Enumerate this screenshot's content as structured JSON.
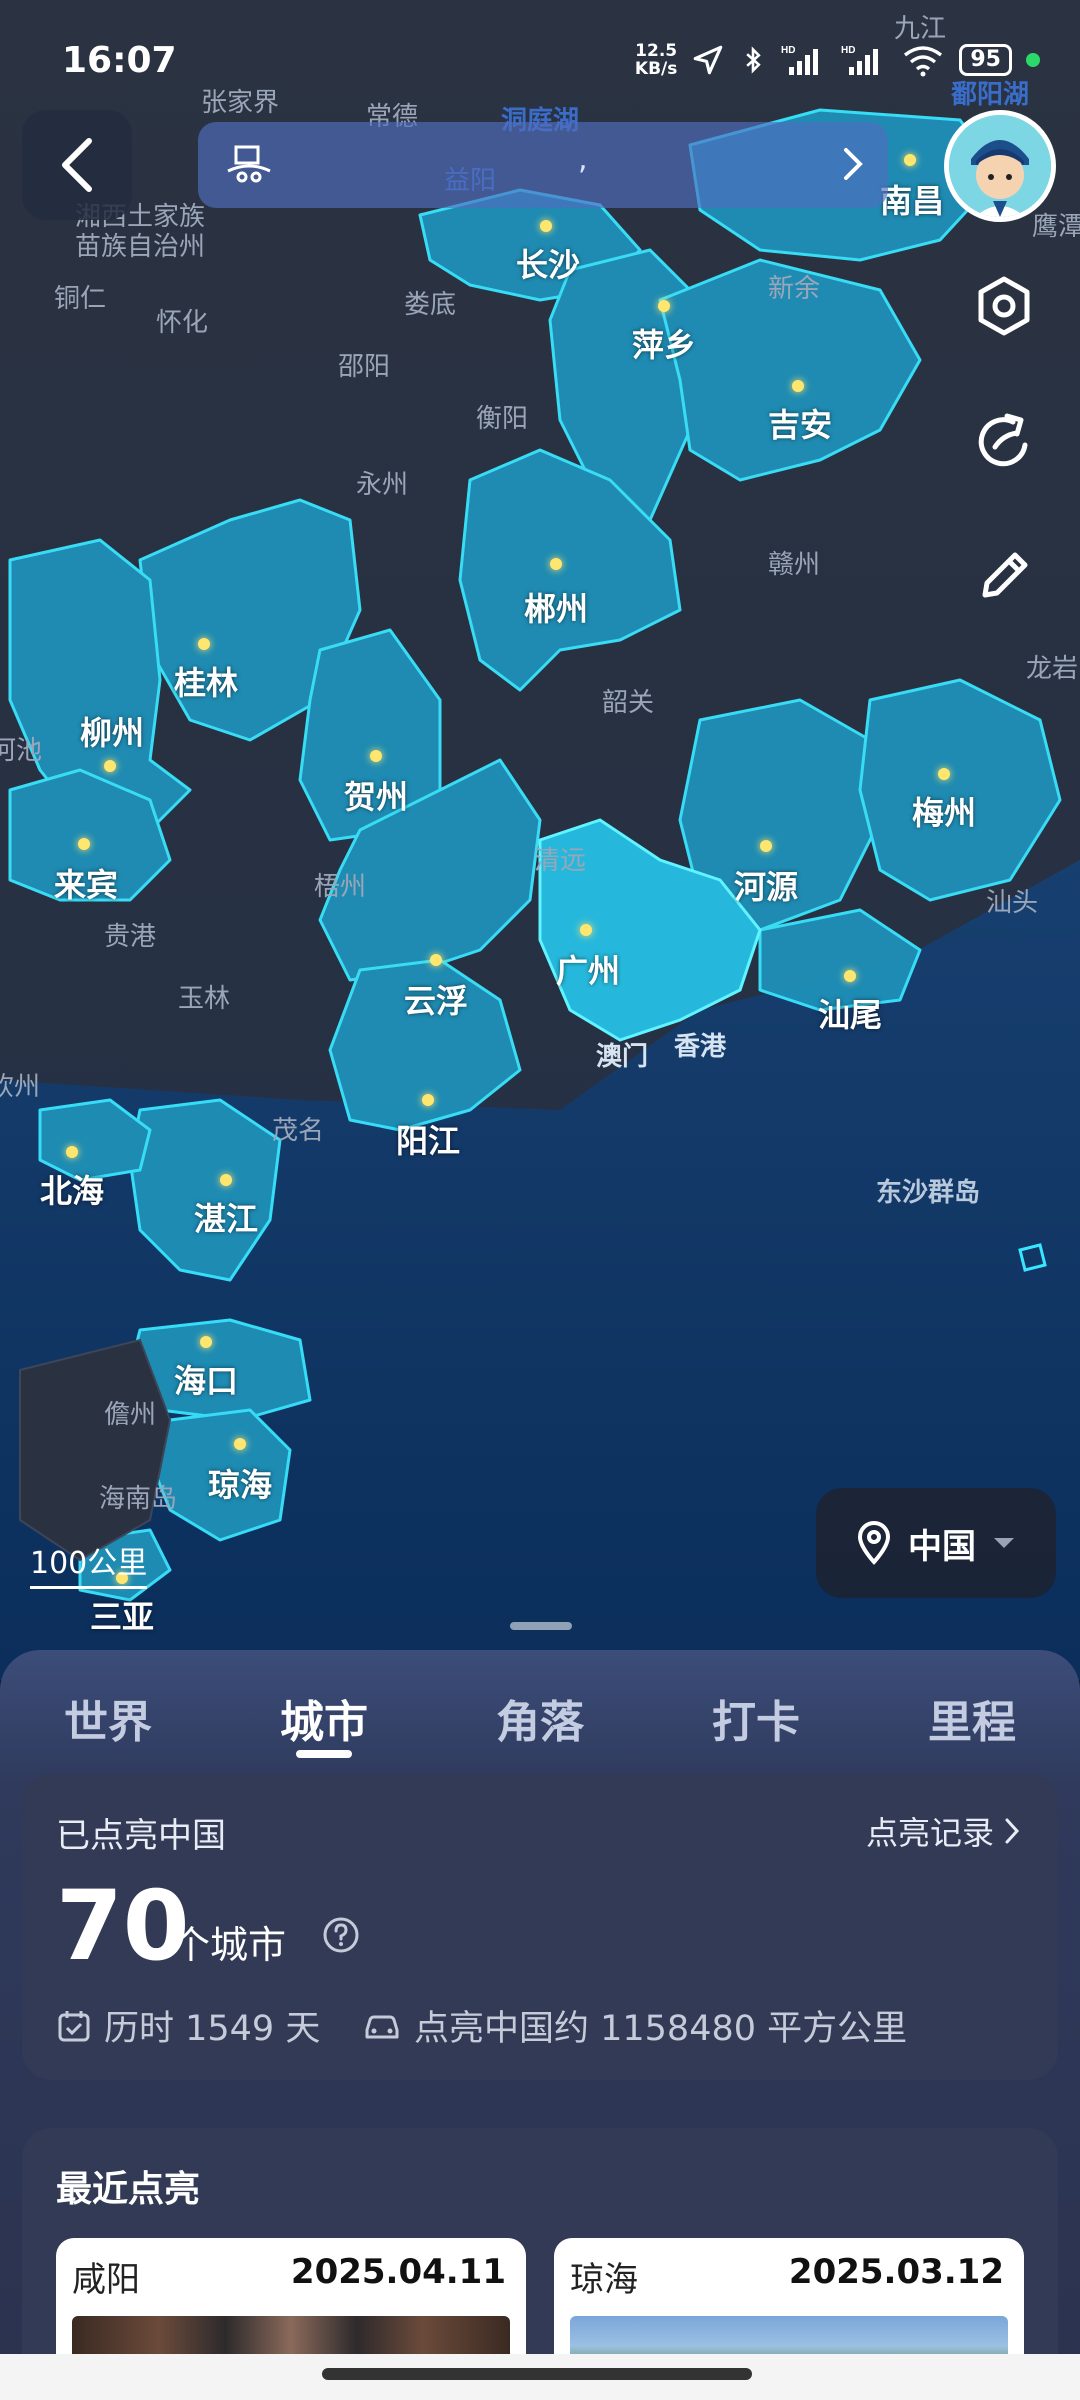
{
  "status_bar": {
    "time": "16:07",
    "net_speed_value": "12.5",
    "net_speed_unit": "KB/s",
    "battery": "95",
    "icons": [
      "location-arrow-icon",
      "bluetooth-icon",
      "signal-hd-icon",
      "signal-hd-icon",
      "wifi-icon",
      "battery-icon"
    ]
  },
  "map": {
    "cities_lit": [
      {
        "name": "南昌"
      },
      {
        "name": "长沙"
      },
      {
        "name": "萍乡"
      },
      {
        "name": "吉安"
      },
      {
        "name": "郴州"
      },
      {
        "name": "桂林"
      },
      {
        "name": "柳州"
      },
      {
        "name": "贺州"
      },
      {
        "name": "来宾"
      },
      {
        "name": "河源"
      },
      {
        "name": "梅州"
      },
      {
        "name": "广州"
      },
      {
        "name": "云浮"
      },
      {
        "name": "汕尾"
      },
      {
        "name": "阳江"
      },
      {
        "name": "北海"
      },
      {
        "name": "湛江"
      },
      {
        "name": "海口"
      },
      {
        "name": "琼海"
      },
      {
        "name": "三亚"
      }
    ],
    "places": [
      {
        "name": "张家界"
      },
      {
        "name": "常德"
      },
      {
        "name": "洞庭湖"
      },
      {
        "name": "九江"
      },
      {
        "name": "鄱阳湖"
      },
      {
        "name": "鹰潭"
      },
      {
        "name": "湘西土家族"
      },
      {
        "name": "苗族自治州"
      },
      {
        "name": "铜仁"
      },
      {
        "name": "怀化"
      },
      {
        "name": "娄底"
      },
      {
        "name": "新余"
      },
      {
        "name": "邵阳"
      },
      {
        "name": "衡阳"
      },
      {
        "name": "永州"
      },
      {
        "name": "赣州"
      },
      {
        "name": "龙岩"
      },
      {
        "name": "韶关"
      },
      {
        "name": "河池"
      },
      {
        "name": "清远"
      },
      {
        "name": "梧州"
      },
      {
        "name": "汕头"
      },
      {
        "name": "贵港"
      },
      {
        "name": "玉林"
      },
      {
        "name": "澳门"
      },
      {
        "name": "香港"
      },
      {
        "name": "钦州"
      },
      {
        "name": "茂名"
      },
      {
        "name": "东沙群岛"
      },
      {
        "name": "儋州"
      },
      {
        "name": "海南岛"
      },
      {
        "name": "益阳"
      }
    ],
    "scale": "100公里",
    "region": "中国",
    "search_placeholder": ","
  },
  "tabs": [
    "世界",
    "城市",
    "角落",
    "打卡",
    "里程"
  ],
  "active_tab": "城市",
  "stats": {
    "title": "已点亮中国",
    "history_link": "点亮记录",
    "count": "70",
    "count_unit": "个城市",
    "duration": "历时 1549 天",
    "area": "点亮中国约 1158480 平方公里"
  },
  "recent": {
    "title": "最近点亮",
    "items": [
      {
        "city": "咸阳",
        "date": "2025.04.11"
      },
      {
        "city": "琼海",
        "date": "2025.03.12"
      }
    ]
  },
  "colors": {
    "lit_region": "#1f9fc4",
    "lit_border": "#3ff0ff",
    "unlit_land": "#2c3443",
    "sea": "#0f3c6e",
    "sheet_bg": "#2b324e"
  }
}
